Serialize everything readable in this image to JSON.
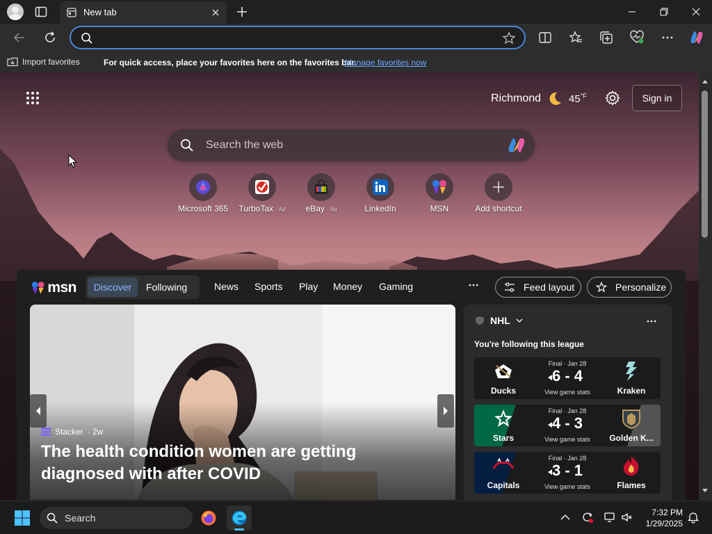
{
  "browser": {
    "tab_title": "New tab",
    "address_value": "",
    "address_placeholder": ""
  },
  "favorites_bar": {
    "import_label": "Import favorites",
    "message": "For quick access, place your favorites here on the favorites bar.",
    "manage_link": "Manage favorites now"
  },
  "newtab": {
    "weather": {
      "city": "Richmond",
      "temp": "45",
      "unit": "°F"
    },
    "sign_in": "Sign in",
    "search_placeholder": "Search the web",
    "shortcuts": [
      {
        "label": "Microsoft 365",
        "ad": ""
      },
      {
        "label": "TurboTax",
        "ad": "· Ad"
      },
      {
        "label": "eBay",
        "ad": "· Ad"
      },
      {
        "label": "LinkedIn",
        "ad": ""
      },
      {
        "label": "MSN",
        "ad": ""
      },
      {
        "label": "Add shortcut",
        "ad": ""
      }
    ]
  },
  "msn": {
    "logo_text": "msn",
    "tabs": {
      "discover": "Discover",
      "following": "Following"
    },
    "nav": [
      "News",
      "Sports",
      "Play",
      "Money",
      "Gaming"
    ],
    "more": "...",
    "feed_layout": "Feed layout",
    "personalize": "Personalize",
    "hero": {
      "source": "Stacker",
      "age": "· 2w",
      "title": "The health condition women are getting diagnosed with after COVID"
    },
    "nhl": {
      "league": "NHL",
      "subtitle": "You're following this league",
      "games": [
        {
          "status": "Final · Jan 28",
          "score": "6 - 4",
          "link": "View game stats",
          "home": "Ducks",
          "away": "Kraken"
        },
        {
          "status": "Final · Jan 28",
          "score": "4 - 3",
          "link": "View game stats",
          "home": "Stars",
          "away": "Golden K..."
        },
        {
          "status": "Final · Jan 28",
          "score": "3 - 1",
          "link": "View game stats",
          "home": "Capitals",
          "away": "Flames"
        }
      ]
    }
  },
  "taskbar": {
    "search_label": "Search",
    "time": "7:32 PM",
    "date": "1/29/2025"
  },
  "colors": {
    "accent": "#4a86d8",
    "link": "#6fa8ff",
    "edge_indicator": "#4cc2ff"
  }
}
